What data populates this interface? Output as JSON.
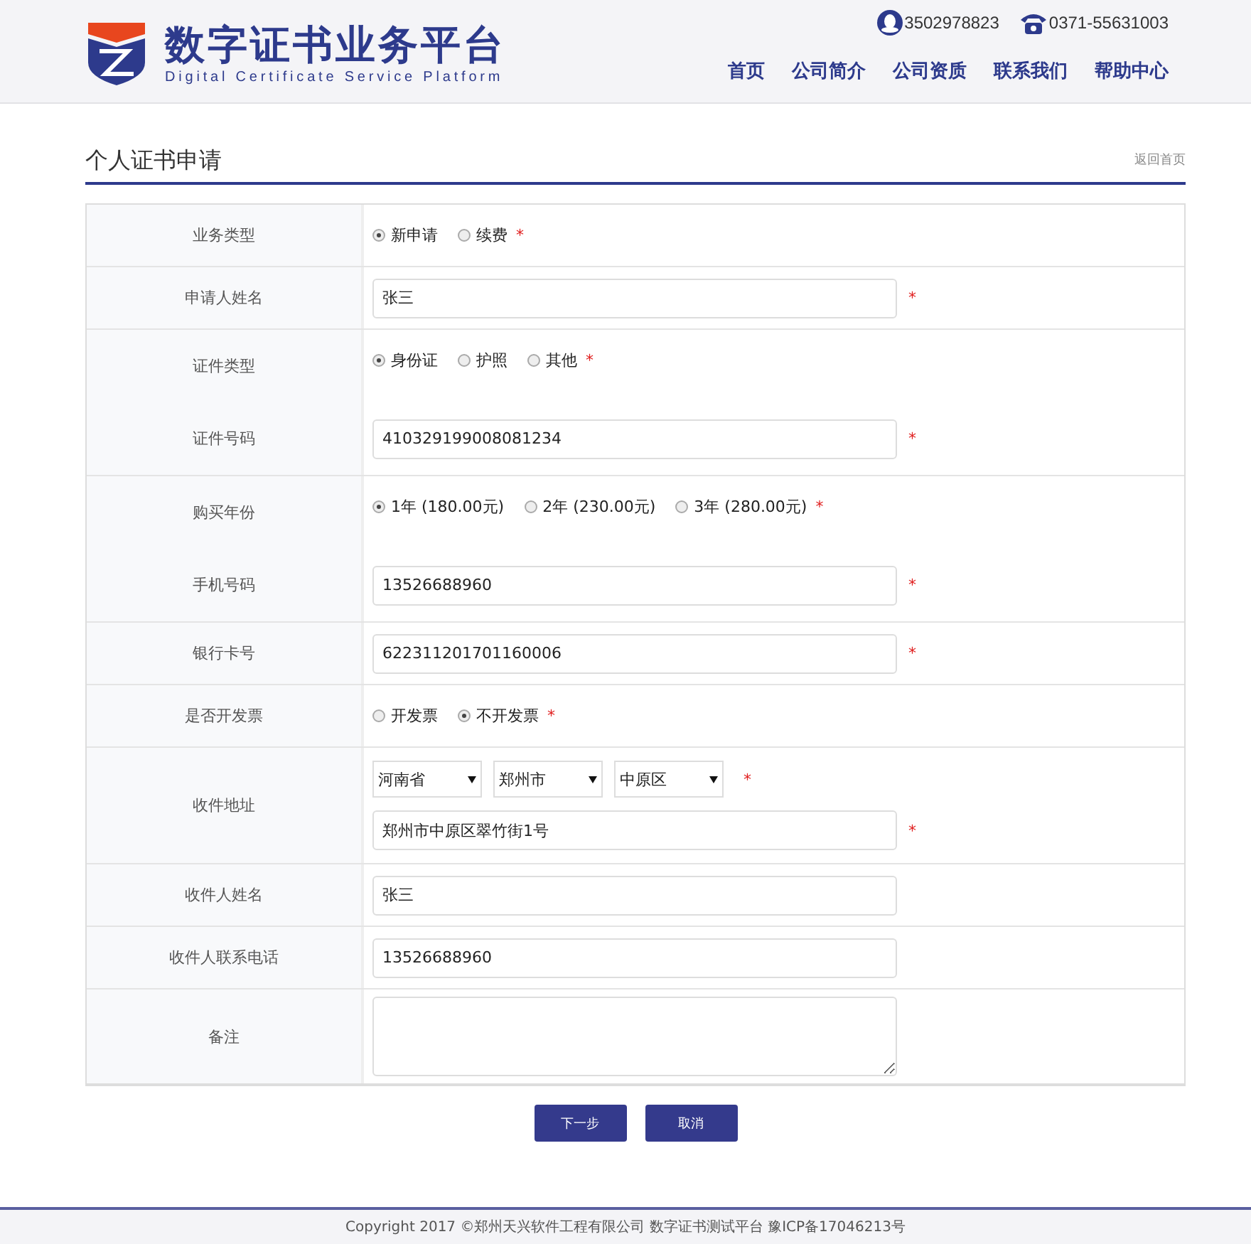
{
  "header": {
    "title": "数字证书业务平台",
    "subtitle": "Digital Certificate Service Platform",
    "contacts": [
      {
        "kind": "qq",
        "text": "3502978823"
      },
      {
        "kind": "phone",
        "text": "0371-55631003"
      }
    ],
    "nav": [
      {
        "label": "首页"
      },
      {
        "label": "公司简介"
      },
      {
        "label": "公司资质"
      },
      {
        "label": "联系我们"
      },
      {
        "label": "帮助中心"
      }
    ]
  },
  "page": {
    "title": "个人证书申请",
    "back_link": "返回首页"
  },
  "sections": [
    {
      "items": [
        {
          "label": "业务类型",
          "kind": "radio",
          "options": [
            {
              "label": "新申请",
              "selected": true
            },
            {
              "label": "续费",
              "selected": false
            }
          ],
          "required_mark": "*"
        }
      ]
    },
    {
      "items": [
        {
          "label": "申请人姓名",
          "kind": "text",
          "value": "张三",
          "required_mark": "*"
        }
      ]
    },
    {
      "items": [
        {
          "label": "证件类型",
          "kind": "radio",
          "options": [
            {
              "label": "身份证",
              "selected": true
            },
            {
              "label": "护照",
              "selected": false
            },
            {
              "label": "其他",
              "selected": false
            }
          ],
          "required_mark": "*"
        },
        {
          "label": "证件号码",
          "kind": "text",
          "value": "410329199008081234",
          "required_mark": "*"
        }
      ]
    },
    {
      "items": [
        {
          "label": "购买年份",
          "kind": "radio",
          "options": [
            {
              "label": "1年 (180.00元)",
              "selected": true
            },
            {
              "label": "2年 (230.00元)",
              "selected": false
            },
            {
              "label": "3年 (280.00元)",
              "selected": false
            }
          ],
          "required_mark": "*"
        },
        {
          "label": "手机号码",
          "kind": "text",
          "value": "13526688960",
          "required_mark": "*"
        }
      ]
    },
    {
      "items": [
        {
          "label": "银行卡号",
          "kind": "text",
          "value": "622311201701160006",
          "required_mark": "*"
        }
      ]
    },
    {
      "items": [
        {
          "label": "是否开发票",
          "kind": "radio",
          "options": [
            {
              "label": "开发票",
              "selected": false
            },
            {
              "label": "不开发票",
              "selected": true
            }
          ],
          "required_mark": "*"
        }
      ]
    },
    {
      "items": [
        {
          "label": "收件地址",
          "kind": "address",
          "selects": [
            "河南省",
            "郑州市",
            "中原区"
          ],
          "select_mark": "*",
          "value": "郑州市中原区翠竹街1号",
          "required_mark": "*"
        }
      ]
    },
    {
      "items": [
        {
          "label": "收件人姓名",
          "kind": "text",
          "value": "张三"
        }
      ]
    },
    {
      "items": [
        {
          "label": "收件人联系电话",
          "kind": "text",
          "value": "13526688960"
        }
      ]
    },
    {
      "items": [
        {
          "label": "备注",
          "kind": "textarea"
        }
      ]
    }
  ],
  "buttons": [
    {
      "label": "下一步"
    },
    {
      "label": "取消"
    }
  ],
  "footer": "Copyright 2017 ©郑州天兴软件工程有限公司 数字证书测试平台 豫ICP备17046213号"
}
